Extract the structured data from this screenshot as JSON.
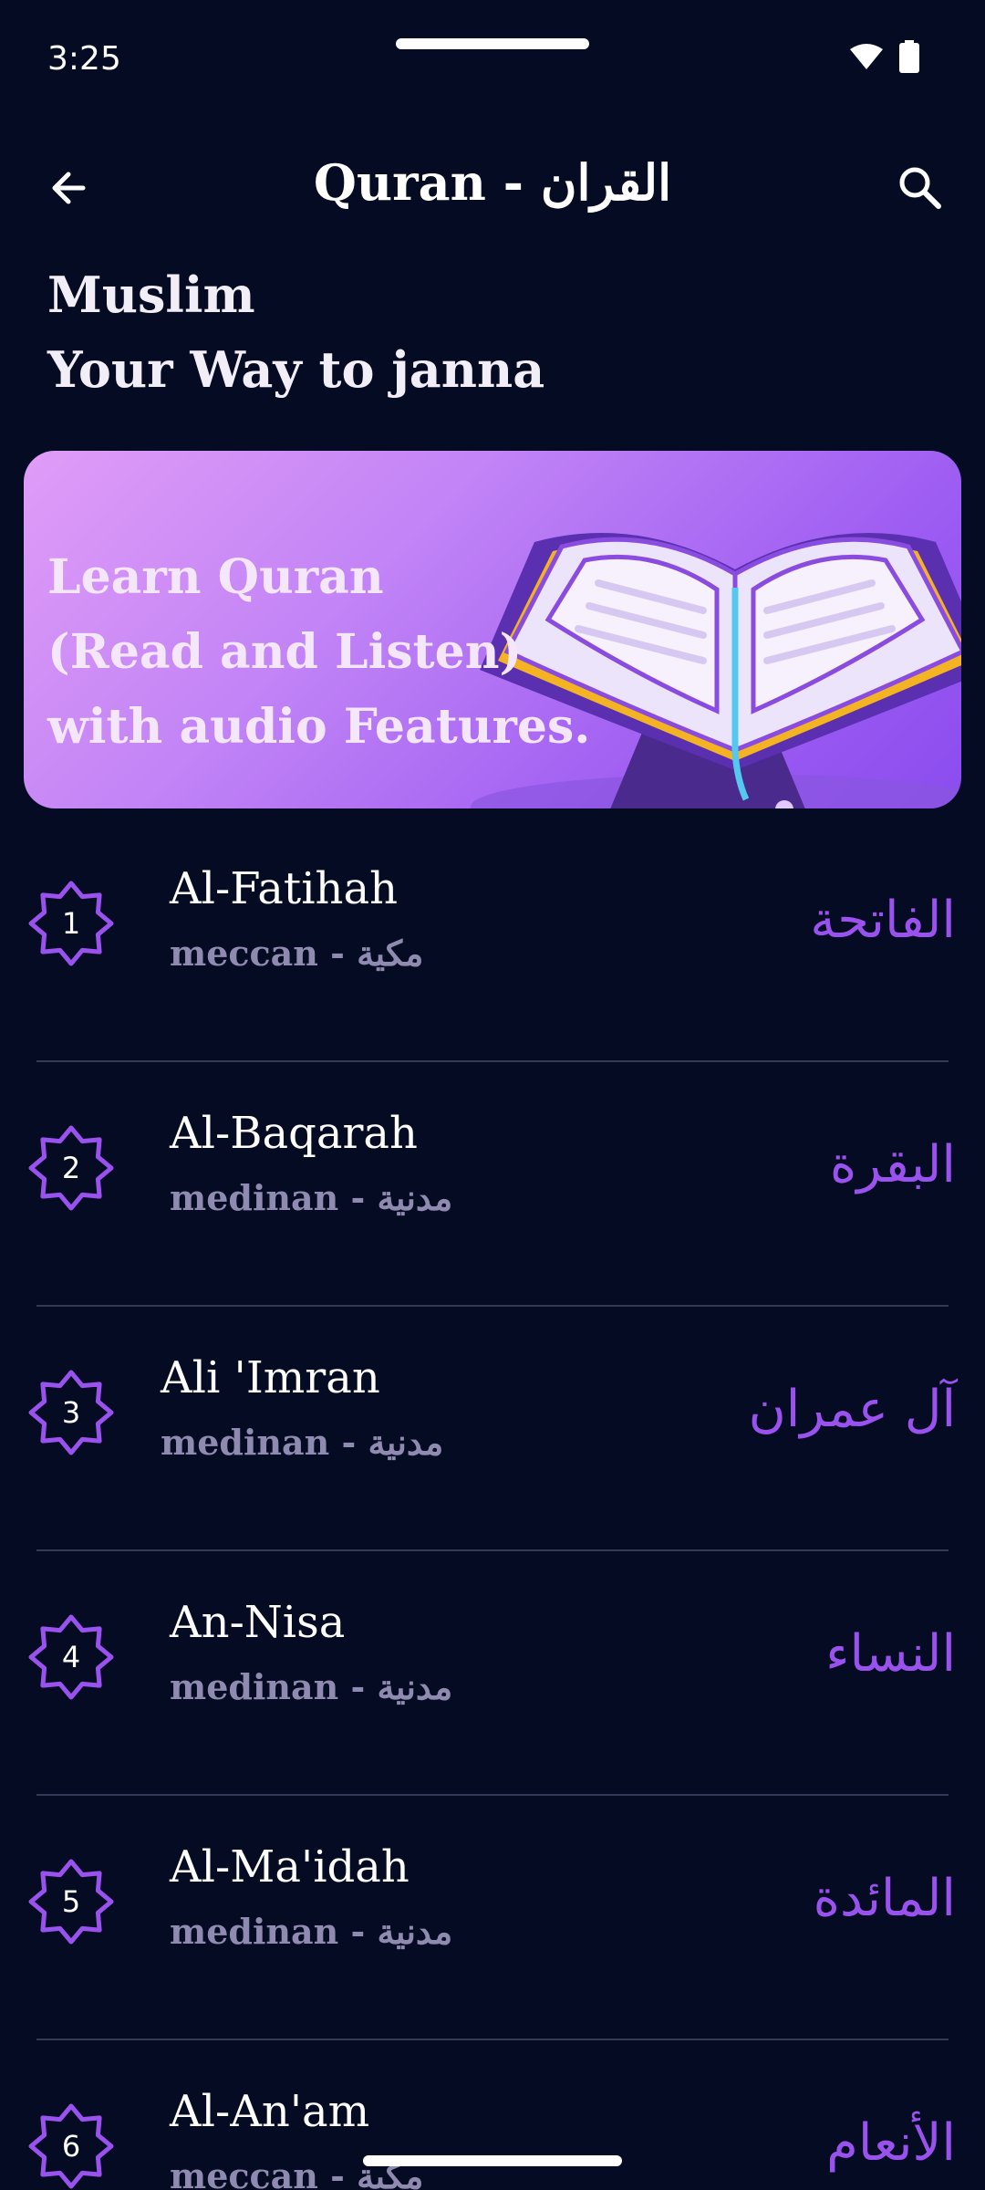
{
  "status_bar": {
    "time": "3:25"
  },
  "app_bar": {
    "title": "Quran - القران"
  },
  "headline": {
    "line1": "Muslim",
    "line2": "Your Way to janna"
  },
  "banner": {
    "line1": "Learn Quran",
    "line2": "(Read and Listen)",
    "line3": "with audio Features."
  },
  "surahs": [
    {
      "number": "1",
      "name_en": "Al-Fatihah",
      "type": "meccan - مكية",
      "name_ar": "الفاتحة"
    },
    {
      "number": "2",
      "name_en": "Al-Baqarah",
      "type": "medinan - مدنية",
      "name_ar": "البقرة"
    },
    {
      "number": "3",
      "name_en": "Ali 'Imran",
      "type": "medinan - مدنية",
      "name_ar": "آل عمران"
    },
    {
      "number": "4",
      "name_en": "An-Nisa",
      "type": "medinan - مدنية",
      "name_ar": "النساء"
    },
    {
      "number": "5",
      "name_en": "Al-Ma'idah",
      "type": "medinan - مدنية",
      "name_ar": "المائدة"
    },
    {
      "number": "6",
      "name_en": "Al-An'am",
      "type": "meccan - مكية",
      "name_ar": "الأنعام"
    }
  ],
  "colors": {
    "background": "#050b22",
    "accent": "#9a52ee",
    "divider": "#343a56"
  }
}
